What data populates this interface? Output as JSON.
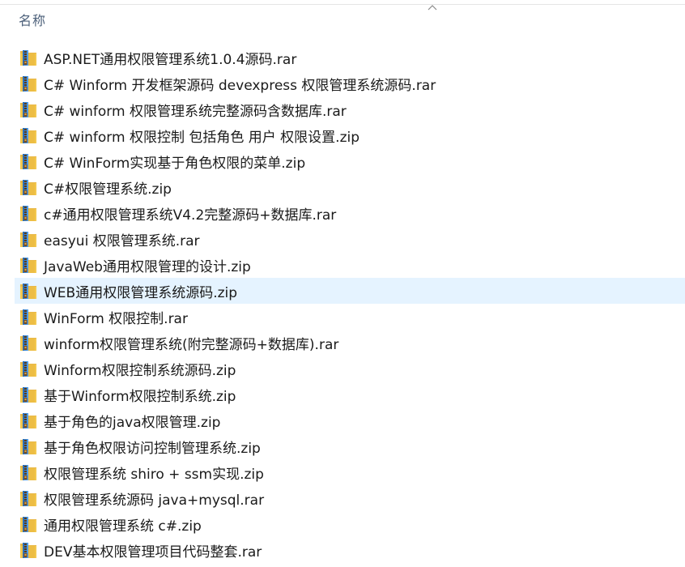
{
  "header": {
    "name_column": "名称"
  },
  "icon": "zip-archive-icon",
  "colors": {
    "hover_row": "#e5f3ff",
    "header_text": "#4c607a"
  },
  "files": [
    "ASP.NET通用权限管理系统1.0.4源码.rar",
    "C# Winform 开发框架源码 devexpress  权限管理系统源码.rar",
    "C# winform 权限管理系统完整源码含数据库.rar",
    "C# winform 权限控制 包括角色 用户 权限设置.zip",
    "C# WinForm实现基于角色权限的菜单.zip",
    "C#权限管理系统.zip",
    "c#通用权限管理系统V4.2完整源码+数据库.rar",
    "easyui 权限管理系统.rar",
    "JavaWeb通用权限管理的设计.zip",
    "WEB通用权限管理系统源码.zip",
    "WinForm 权限控制.rar",
    "winform权限管理系统(附完整源码+数据库).rar",
    "Winform权限控制系统源码.zip",
    "基于Winform权限控制系统.zip",
    "基于角色的java权限管理.zip",
    "基于角色权限访问控制管理系统.zip",
    "权限管理系统 shiro + ssm实现.zip",
    "权限管理系统源码 java+mysql.rar",
    "通用权限管理系统 c#.zip",
    "DEV基本权限管理项目代码整套.rar"
  ],
  "hovered_index": 9
}
